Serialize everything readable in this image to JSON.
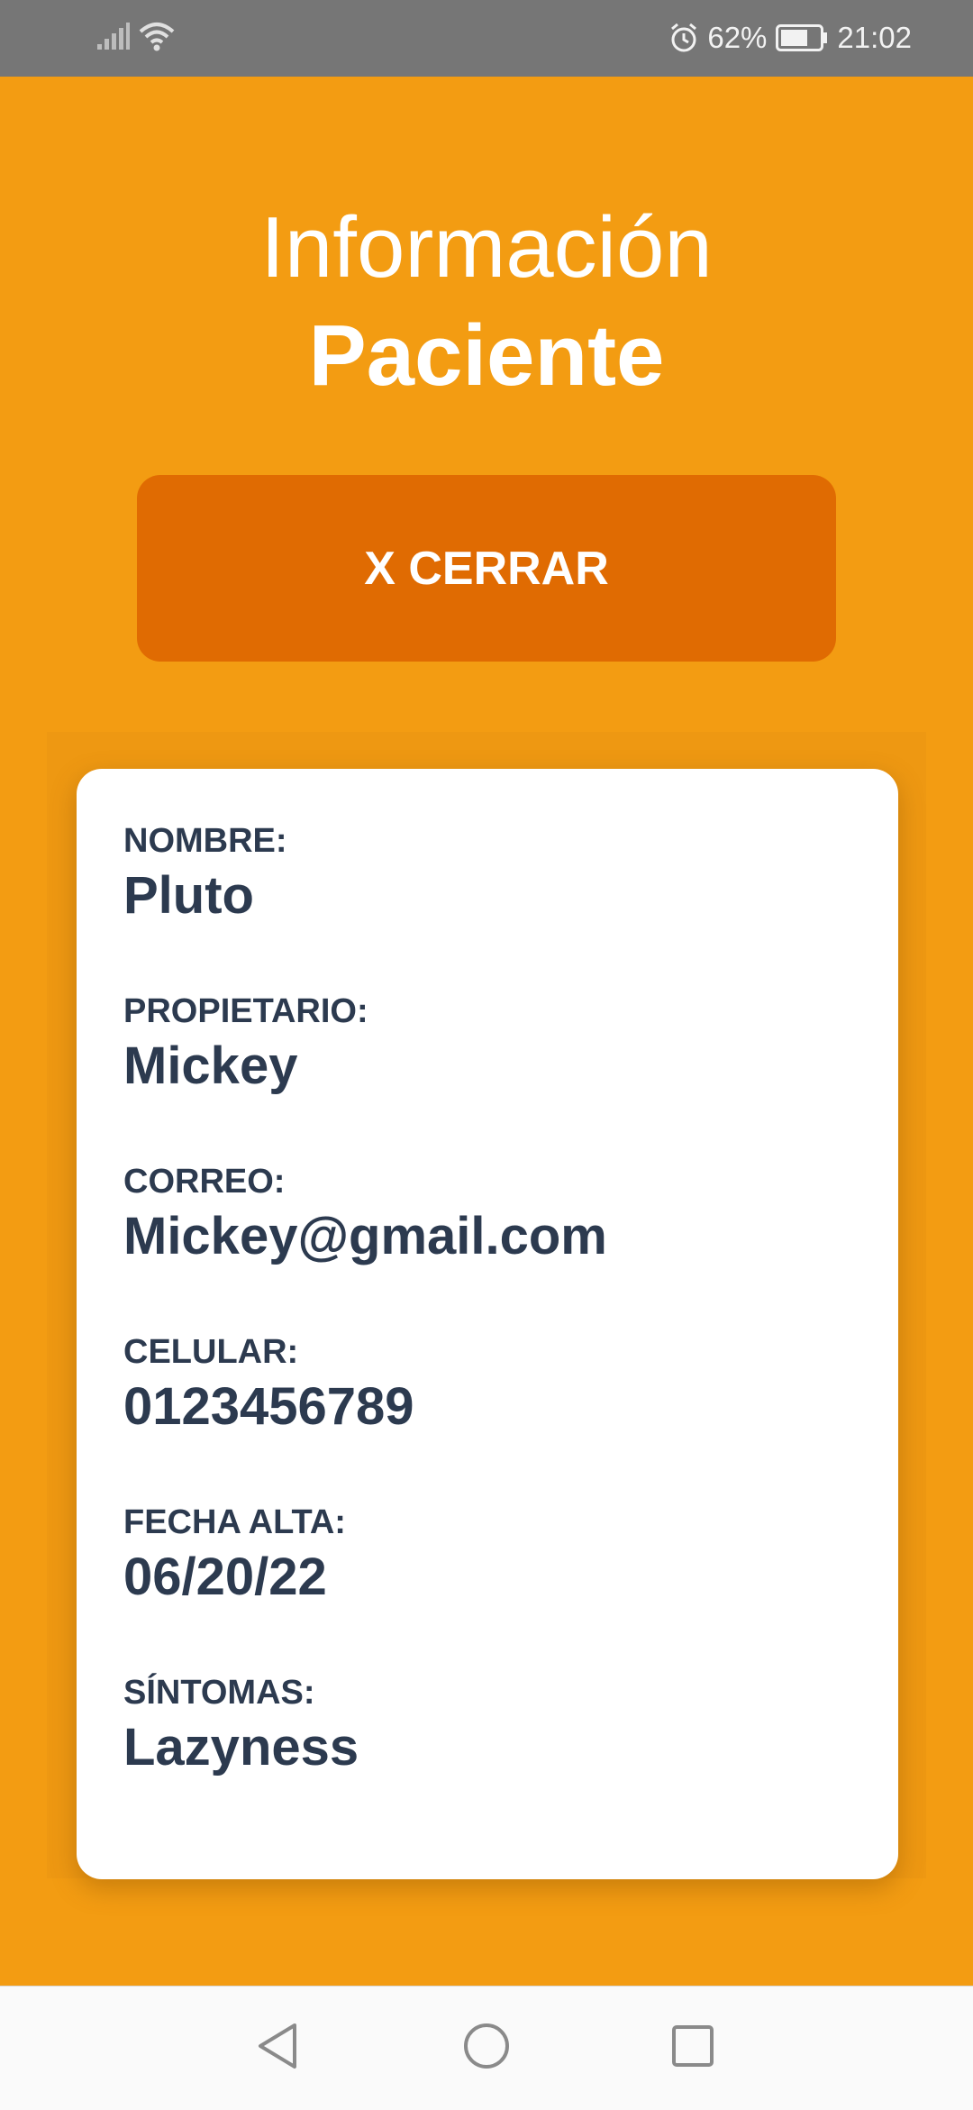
{
  "status_bar": {
    "battery": "62%",
    "time": "21:02",
    "icons": [
      "signal-icon",
      "wifi-icon",
      "alarm-icon",
      "battery-icon"
    ]
  },
  "header": {
    "title_line1": "Información",
    "title_line2": "Paciente"
  },
  "close_button": {
    "label": "X CERRAR"
  },
  "patient": {
    "fields": [
      {
        "label": "NOMBRE:",
        "value": "Pluto"
      },
      {
        "label": "PROPIETARIO:",
        "value": "Mickey"
      },
      {
        "label": "CORREO:",
        "value": "Mickey@gmail.com"
      },
      {
        "label": "CELULAR:",
        "value": "0123456789"
      },
      {
        "label": "FECHA ALTA:",
        "value": "06/20/22"
      },
      {
        "label": "SÍNTOMAS:",
        "value": "Lazyness"
      }
    ]
  },
  "nav_bar": {
    "buttons": [
      "back-icon",
      "home-icon",
      "recents-icon"
    ]
  },
  "colors": {
    "background": "#f39c12",
    "button": "#e06b02",
    "card": "#ffffff",
    "text": "#2c3a4f",
    "status_bar": "#767676"
  }
}
